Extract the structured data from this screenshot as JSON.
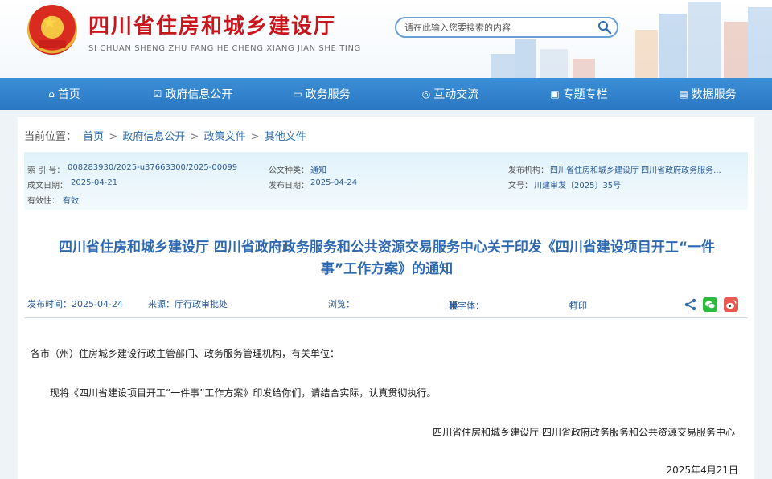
{
  "header": {
    "title": "四川省住房和城乡建设厅",
    "pinyin": "SI CHUAN SHENG ZHU FANG HE CHENG XIANG JIAN SHE TING",
    "emblem_icon": "national-emblem-icon",
    "search_placeholder": "请在此输入您要搜索的内容",
    "search_icon": "search-icon"
  },
  "nav": [
    {
      "label": "首页",
      "icon": "home-icon",
      "glyph": "⌂"
    },
    {
      "label": "政府信息公开",
      "icon": "edit-icon",
      "glyph": "☑"
    },
    {
      "label": "政务服务",
      "icon": "monitor-icon",
      "glyph": "▭"
    },
    {
      "label": "互动交流",
      "icon": "chat-icon",
      "glyph": "◎"
    },
    {
      "label": "专题专栏",
      "icon": "image-icon",
      "glyph": "▣"
    },
    {
      "label": "数据服务",
      "icon": "data-icon",
      "glyph": "▤"
    }
  ],
  "breadcrumb": {
    "prefix": "当前位置：",
    "items": [
      "首页",
      "政府信息公开",
      "政策文件",
      "其他文件"
    ],
    "separator": ">"
  },
  "meta": {
    "index_label": "索 引 号：",
    "index_value": "008283930/2025-u37663300/2025-00099",
    "type_label": "公文种类：",
    "type_value": "通知",
    "issuer_label": "发布机构：",
    "issuer_value": "四川省住房和城乡建设厅 四川省政府政务服务...",
    "created_label": "成文日期：",
    "created_value": "2025-04-21",
    "published_label": "发布日期：",
    "published_value": "2025-04-24",
    "docno_label": "文号：",
    "docno_value": "川建审发〔2025〕35号",
    "validity_label": "有效性：",
    "validity_value": "有效"
  },
  "article": {
    "title_line1": "四川省住房和城乡建设厅 四川省政府政务服务和公共资源交易服务中心关于印发《四川省建设项目开工“一件",
    "title_line2": "事”工作方案》的通知",
    "publish_time": "发布时间：2025-04-24",
    "source": "来源：厅行政审批处",
    "views": "浏览：",
    "font_size_prefix": "【字体：",
    "font_size_options": [
      "大",
      "中",
      "小"
    ],
    "font_size_suffix": "】",
    "print": "打印",
    "salutation": "各市（州）住房城乡建设行政主管部门、政务服务管理机构，有关单位：",
    "paragraph": "现将《四川省建设项目开工“一件事”工作方案》印发给你们，请结合实际，认真贯彻执行。",
    "signature": "四川省住房和城乡建设厅 四川省政府政务服务和公共资源交易服务中心",
    "date": "2025年4月21日"
  },
  "colors": {
    "brand_red": "#c8161d",
    "nav_blue": "#2f82cc",
    "link_blue": "#2f6db0",
    "wechat_green": "#2dbb3e",
    "weibo_red": "#e85a4f"
  }
}
